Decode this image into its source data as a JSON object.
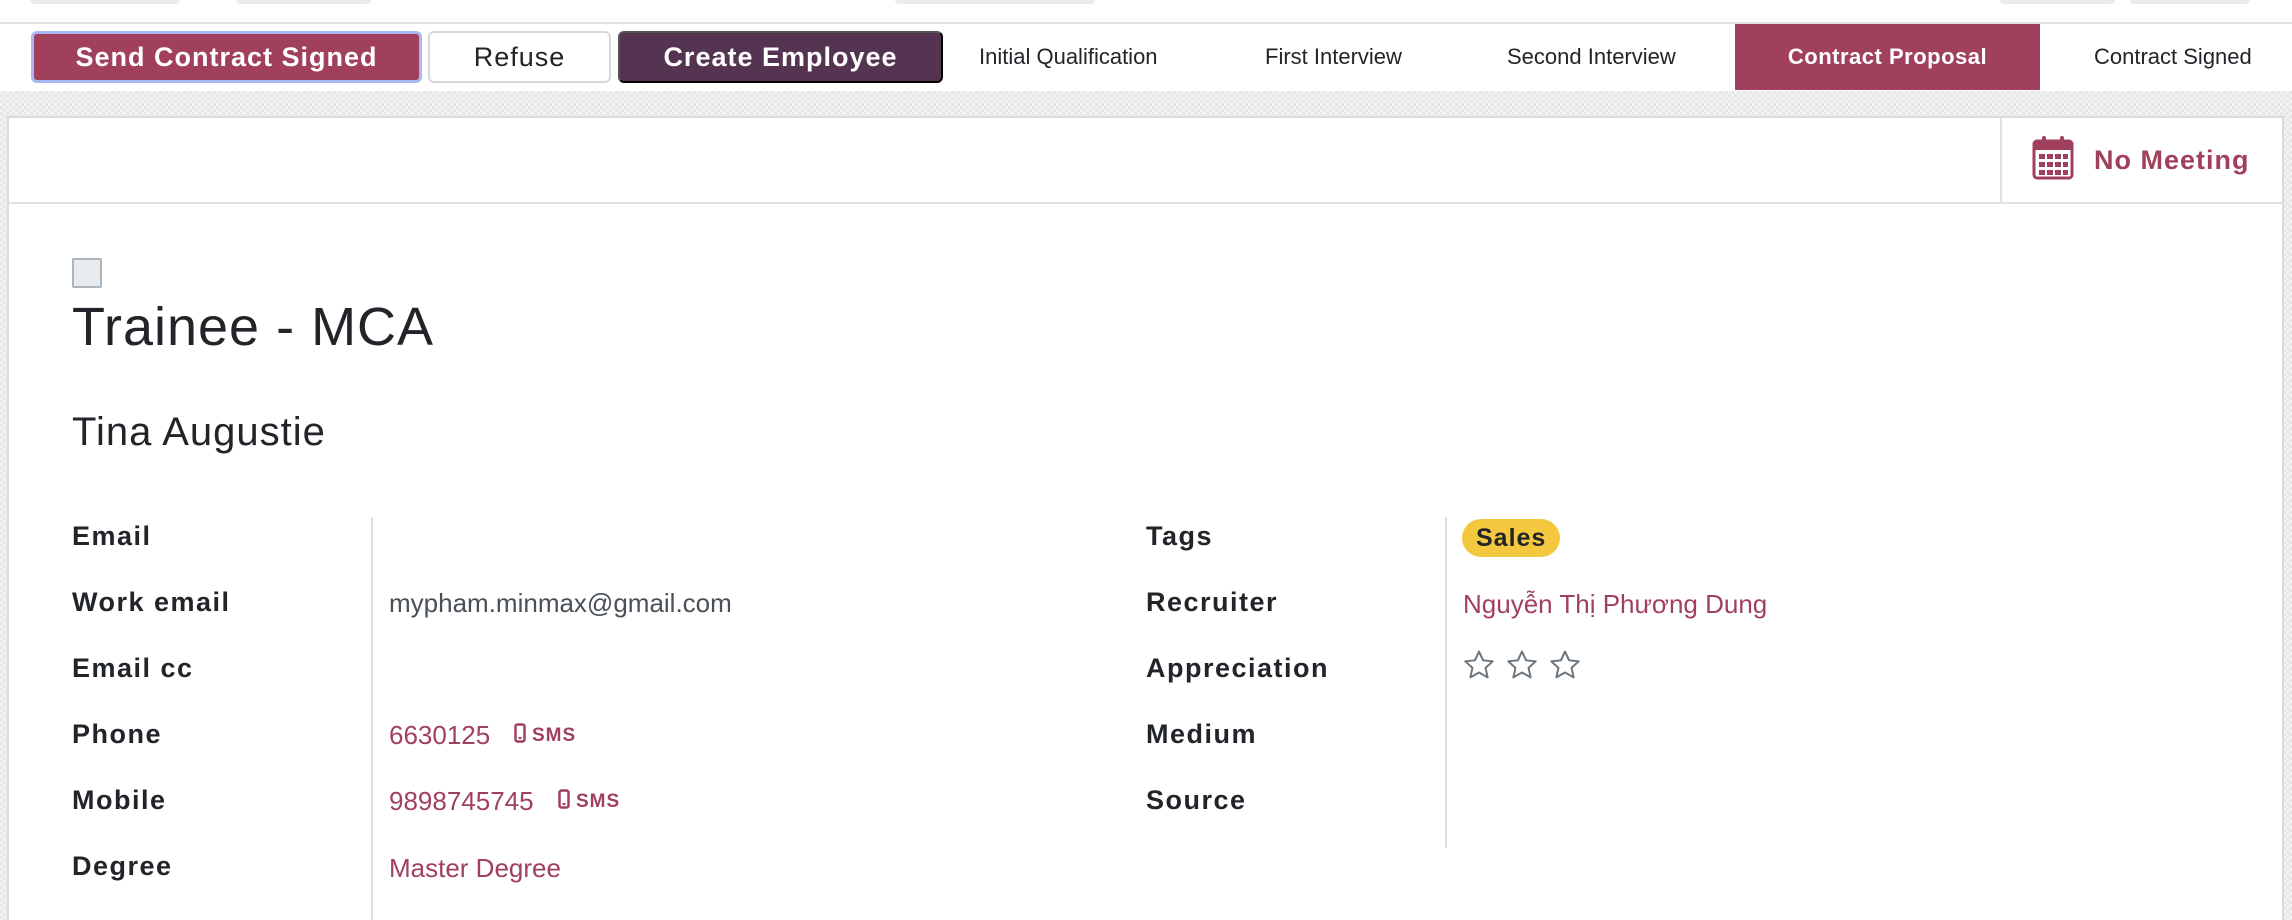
{
  "header": {
    "actions": {
      "send_contract_signed": "Send Contract Signed",
      "refuse": "Refuse",
      "create_employee": "Create Employee"
    },
    "stages": [
      {
        "label": "Initial Qualification",
        "active": false
      },
      {
        "label": "First Interview",
        "active": false
      },
      {
        "label": "Second Interview",
        "active": false
      },
      {
        "label": "Contract Proposal",
        "active": true
      },
      {
        "label": "Contract Signed",
        "active": false
      }
    ]
  },
  "smart_buttons": {
    "meeting": {
      "label": "No Meeting",
      "icon": "calendar-icon"
    }
  },
  "form": {
    "job_title": "Trainee - MCA",
    "applicant_name": "Tina Augustie",
    "left_fields": {
      "email": {
        "label": "Email",
        "value": ""
      },
      "work_email": {
        "label": "Work email",
        "value": "mypham.minmax@gmail.com"
      },
      "email_cc": {
        "label": "Email cc",
        "value": ""
      },
      "phone": {
        "label": "Phone",
        "value": "6630125",
        "sms": "SMS"
      },
      "mobile": {
        "label": "Mobile",
        "value": "9898745745",
        "sms": "SMS"
      },
      "degree": {
        "label": "Degree",
        "value": "Master Degree"
      }
    },
    "right_fields": {
      "tags": {
        "label": "Tags",
        "values": [
          "Sales"
        ]
      },
      "recruiter": {
        "label": "Recruiter",
        "value": "Nguyễn Thị Phương Dung"
      },
      "appreciation": {
        "label": "Appreciation",
        "stars_filled": 0,
        "stars_total": 3
      },
      "medium": {
        "label": "Medium",
        "value": ""
      },
      "source": {
        "label": "Source",
        "value": ""
      }
    }
  },
  "colors": {
    "brand": "#a1405c",
    "dark": "#553451",
    "tag_sales": "#f3c83e",
    "focus_ring": "#a9b7f2"
  }
}
